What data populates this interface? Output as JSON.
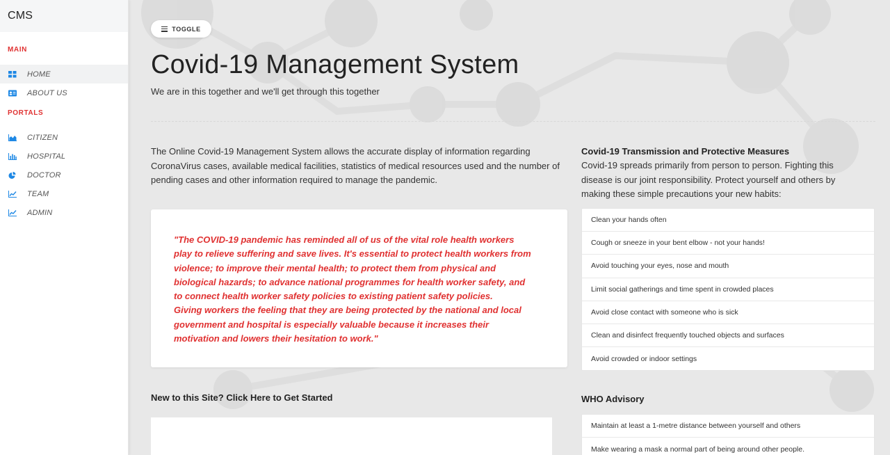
{
  "sidebar": {
    "brand": "CMS",
    "sections": [
      {
        "title": "MAIN",
        "items": [
          {
            "label": "HOME",
            "icon": "grid-icon",
            "active": true
          },
          {
            "label": "ABOUT US",
            "icon": "id-card-icon",
            "active": false
          }
        ]
      },
      {
        "title": "PORTALS",
        "items": [
          {
            "label": "CITIZEN",
            "icon": "area-chart-icon"
          },
          {
            "label": "HOSPITAL",
            "icon": "bar-chart-icon"
          },
          {
            "label": "DOCTOR",
            "icon": "pie-chart-icon"
          },
          {
            "label": "TEAM",
            "icon": "line-chart-icon"
          },
          {
            "label": "ADMIN",
            "icon": "line-chart-icon"
          }
        ]
      }
    ],
    "accent_color": "#e03131",
    "icon_color": "#1e88e5"
  },
  "header": {
    "toggle_label": "TOGGLE",
    "title": "Covid-19 Management System",
    "subtitle": "We are in this together and we'll get through this together"
  },
  "main": {
    "intro": "The Online Covid-19 Management System allows the accurate display of information regarding CoronaVirus cases, available medical facilities, statistics of medical resources used and the number of pending cases and other information required to manage the pandemic.",
    "quote_lines": [
      "\"The COVID-19 pandemic has reminded all of us of the vital role health workers",
      "play to relieve suffering and save lives. It's essential to protect health workers from",
      "violence; to improve their mental health; to protect them from physical and",
      "biological hazards; to advance national programmes for health worker safety, and",
      "to connect health worker safety policies to existing patient safety policies.",
      "Giving workers the feeling that they are being protected by the national and local",
      "government and hospital is especially valuable because it increases their",
      "motivation and lowers their hesitation to work.\""
    ],
    "get_started_title": "New to this Site? Click Here to Get Started"
  },
  "measures": {
    "title": "Covid-19 Transmission and Protective Measures",
    "description": "Covid-19 spreads primarily from person to person. Fighting this disease is our joint responsibility. Protect yourself and others by making these simple precautions your new habits:",
    "items": [
      "Clean your hands often",
      "Cough or sneeze in your bent elbow - not your hands!",
      "Avoid touching your eyes, nose and mouth",
      "Limit social gatherings and time spent in crowded places",
      "Avoid close contact with someone who is sick",
      "Clean and disinfect frequently touched objects and surfaces",
      "Avoid crowded or indoor settings"
    ]
  },
  "who": {
    "title": "WHO Advisory",
    "items": [
      "Maintain at least a 1-metre distance between yourself and others",
      "Make wearing a mask a normal part of being around other people."
    ]
  }
}
